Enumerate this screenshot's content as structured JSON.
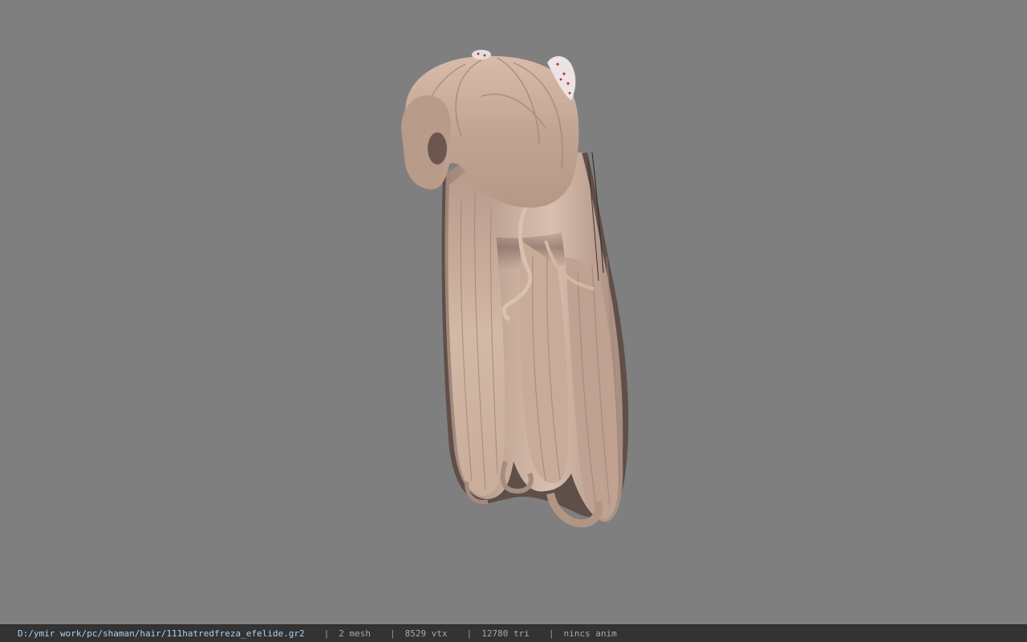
{
  "viewport": {
    "background": "#7f7f7f",
    "model": "hair-mesh"
  },
  "statusbar": {
    "file_path": "D:/ymir work/pc/shaman/hair/111hatredfreza_efelide.gr2",
    "separator": "|",
    "mesh_count": "2 mesh",
    "vertex_count": "8529 vtx",
    "triangle_count": "12780 tri",
    "anim_status": "nincs anim"
  }
}
